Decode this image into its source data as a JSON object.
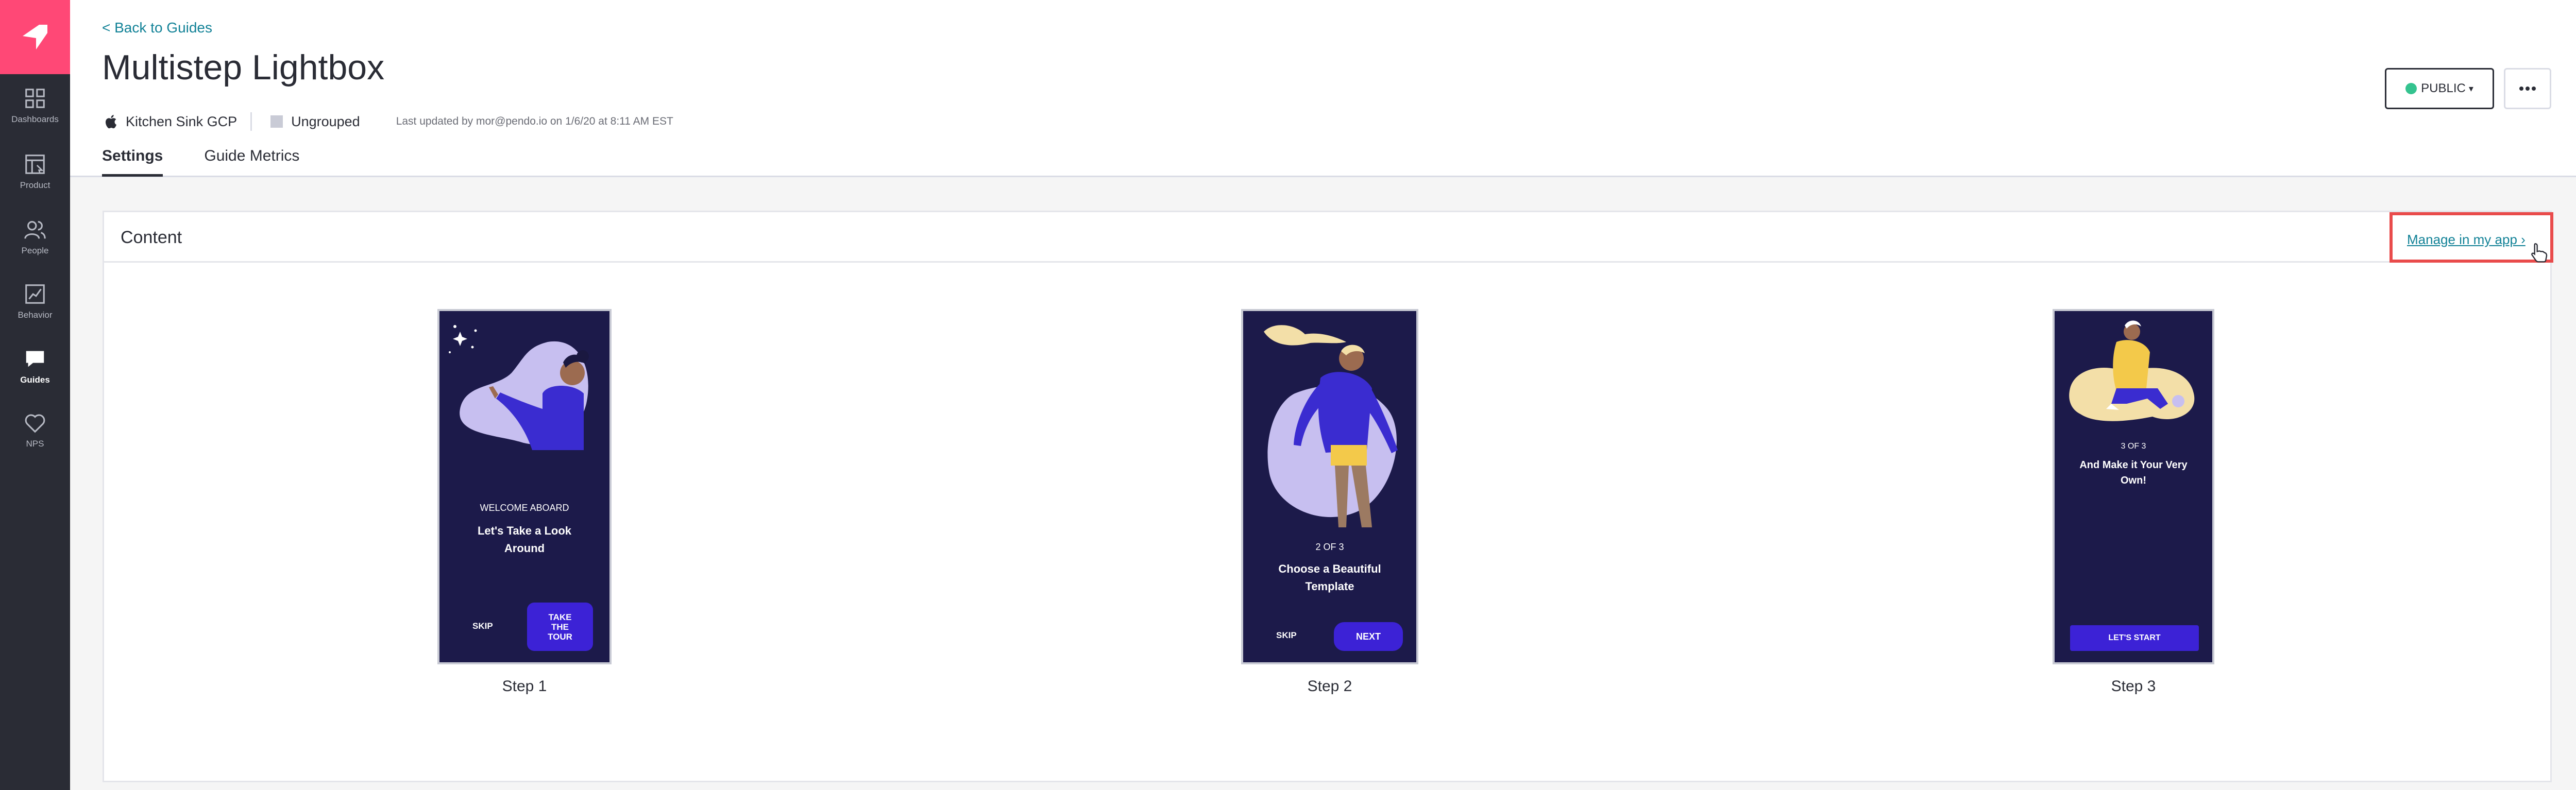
{
  "sidebar": {
    "items": [
      {
        "label": "Dashboards",
        "icon": "dashboards-icon"
      },
      {
        "label": "Product",
        "icon": "product-icon"
      },
      {
        "label": "People",
        "icon": "people-icon"
      },
      {
        "label": "Behavior",
        "icon": "behavior-icon"
      },
      {
        "label": "Guides",
        "icon": "guides-icon",
        "active": true
      },
      {
        "label": "NPS",
        "icon": "heart-icon"
      }
    ]
  },
  "header": {
    "back_link": "< Back to Guides",
    "title": "Multistep Lightbox",
    "app_name": "Kitchen Sink GCP",
    "group": "Ungrouped",
    "last_updated": "Last updated by mor@pendo.io on 1/6/20 at 8:11 AM EST",
    "status_label": "PUBLIC",
    "more_label": "•••",
    "tabs": [
      {
        "label": "Settings",
        "active": true
      },
      {
        "label": "Guide Metrics",
        "active": false
      }
    ]
  },
  "content": {
    "title": "Content",
    "manage_link": "Manage in my app ›",
    "steps": [
      {
        "label": "Step 1",
        "kicker": "WELCOME ABOARD",
        "heading_line1": "Let's Take a Look",
        "heading_line2": "Around",
        "skip": "SKIP",
        "cta": "TAKE THE TOUR"
      },
      {
        "label": "Step 2",
        "kicker": "2 OF 3",
        "heading_line1": "Choose a Beautiful",
        "heading_line2": "Template",
        "skip": "SKIP",
        "cta": "NEXT"
      },
      {
        "label": "Step 3",
        "kicker": "3 OF 3",
        "heading_line1": "And Make it Your Very",
        "heading_line2": "Own!",
        "cta": "LET'S START"
      }
    ]
  },
  "colors": {
    "brand": "#ff4876",
    "sidebar": "#2a2c35",
    "link": "#128297",
    "status_public": "#34c38f",
    "highlight": "#e94b4b",
    "slide_bg": "#1c1a4a",
    "slide_button": "#3c22d6"
  }
}
